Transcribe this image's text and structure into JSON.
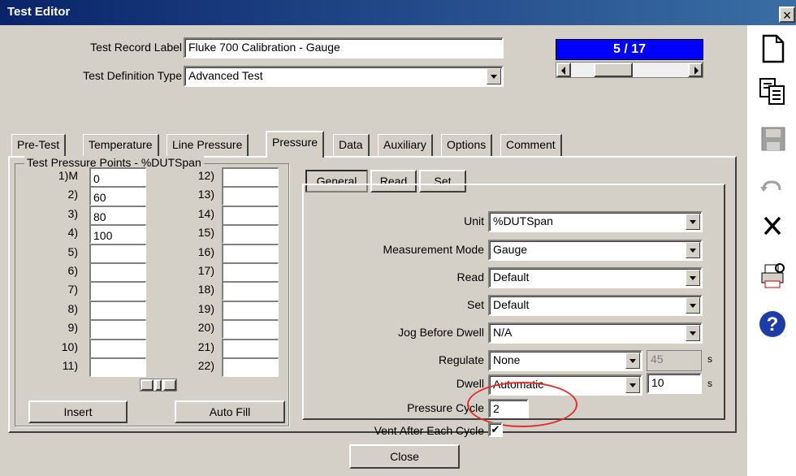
{
  "window": {
    "title": "Test Editor",
    "close_glyph": "×"
  },
  "record": {
    "label_caption": "Test Record Label",
    "label_value": "Fluke 700 Calibration - Gauge",
    "type_caption": "Test Definition Type",
    "type_value": "Advanced Test"
  },
  "navigator": {
    "position": "5 / 17"
  },
  "tabs": [
    "Pre-Test",
    "Temperature",
    "Line Pressure",
    "Pressure",
    "Data",
    "Auxiliary",
    "Options",
    "Comment"
  ],
  "points": {
    "legend": "Test Pressure Points - %DUTSpan",
    "left_labels": [
      "1)M",
      "2)",
      "3)",
      "4)",
      "5)",
      "6)",
      "7)",
      "8)",
      "9)",
      "10)",
      "11)"
    ],
    "left_values": [
      "0",
      "60",
      "80",
      "100",
      "",
      "",
      "",
      "",
      "",
      "",
      ""
    ],
    "right_labels": [
      "12)",
      "13)",
      "14)",
      "15)",
      "16)",
      "17)",
      "18)",
      "19)",
      "20)",
      "21)",
      "22)"
    ],
    "right_values": [
      "",
      "",
      "",
      "",
      "",
      "",
      "",
      "",
      "",
      "",
      ""
    ],
    "insert_label": "Insert",
    "autofill_label": "Auto Fill"
  },
  "subtabs": [
    "General",
    "Read",
    "Set"
  ],
  "general": {
    "unit_label": "Unit",
    "unit_value": "%DUTSpan",
    "mode_label": "Measurement Mode",
    "mode_value": "Gauge",
    "read_label": "Read",
    "read_value": "Default",
    "set_label": "Set",
    "set_value": "Default",
    "jog_label": "Jog Before Dwell",
    "jog_value": "N/A",
    "regulate_label": "Regulate",
    "regulate_value": "None",
    "regulate_num": "45",
    "regulate_unit": "s",
    "dwell_label": "Dwell",
    "dwell_value": "Automatic",
    "dwell_num": "10",
    "dwell_unit": "s",
    "cycle_label": "Pressure Cycle",
    "cycle_value": "2",
    "vent_label": "Vent After Each Cycle",
    "vent_checked": "✔"
  },
  "close_label": "Close",
  "icons": [
    "new-doc-icon",
    "copy-icon",
    "save-icon",
    "undo-icon",
    "delete-icon",
    "print-settings-icon",
    "help-icon"
  ],
  "colors": {
    "title_bar": "#0a246a",
    "counter_bg": "#0000ff",
    "highlight_circle": "#e03030",
    "help_blue": "#1e3ca8"
  }
}
